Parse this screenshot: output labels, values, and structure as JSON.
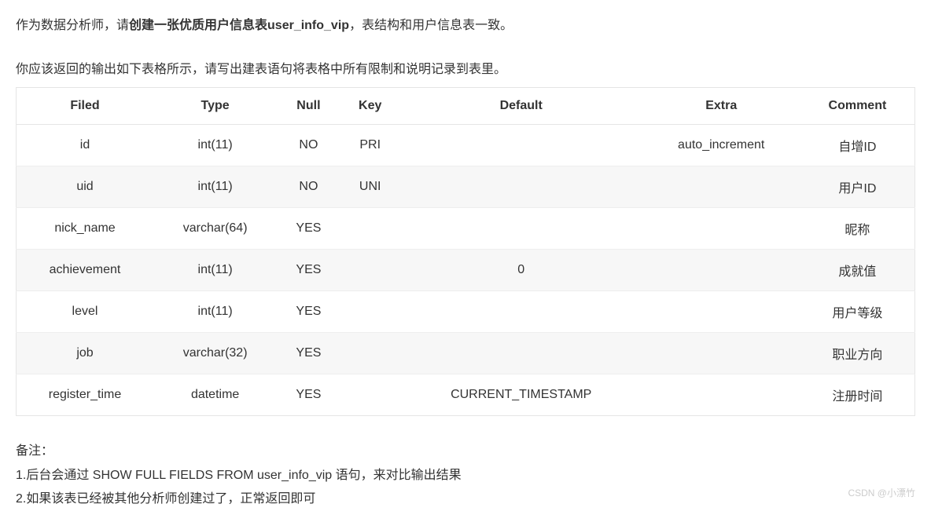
{
  "intro": {
    "prefix": "作为数据分析师，请",
    "bold": "创建一张优质用户信息表user_info_vip",
    "suffix": "，表结构和用户信息表一致。"
  },
  "subtitle": "你应该返回的输出如下表格所示，请写出建表语句将表格中所有限制和说明记录到表里。",
  "table": {
    "headers": [
      "Filed",
      "Type",
      "Null",
      "Key",
      "Default",
      "Extra",
      "Comment"
    ],
    "rows": [
      [
        "id",
        "int(11)",
        "NO",
        "PRI",
        "",
        "auto_increment",
        "自增ID"
      ],
      [
        "uid",
        "int(11)",
        "NO",
        "UNI",
        "",
        "",
        "用户ID"
      ],
      [
        "nick_name",
        "varchar(64)",
        "YES",
        "",
        "",
        "",
        "昵称"
      ],
      [
        "achievement",
        "int(11)",
        "YES",
        "",
        "0",
        "",
        "成就值"
      ],
      [
        "level",
        "int(11)",
        "YES",
        "",
        "",
        "",
        "用户等级"
      ],
      [
        "job",
        "varchar(32)",
        "YES",
        "",
        "",
        "",
        "职业方向"
      ],
      [
        "register_time",
        "datetime",
        "YES",
        "",
        "CURRENT_TIMESTAMP",
        "",
        "注册时间"
      ]
    ]
  },
  "notes": {
    "title": "备注：",
    "line1": "1.后台会通过 SHOW FULL FIELDS FROM user_info_vip 语句，来对比输出结果",
    "line2": "2.如果该表已经被其他分析师创建过了，正常返回即可"
  },
  "watermark": "CSDN @小漂竹"
}
